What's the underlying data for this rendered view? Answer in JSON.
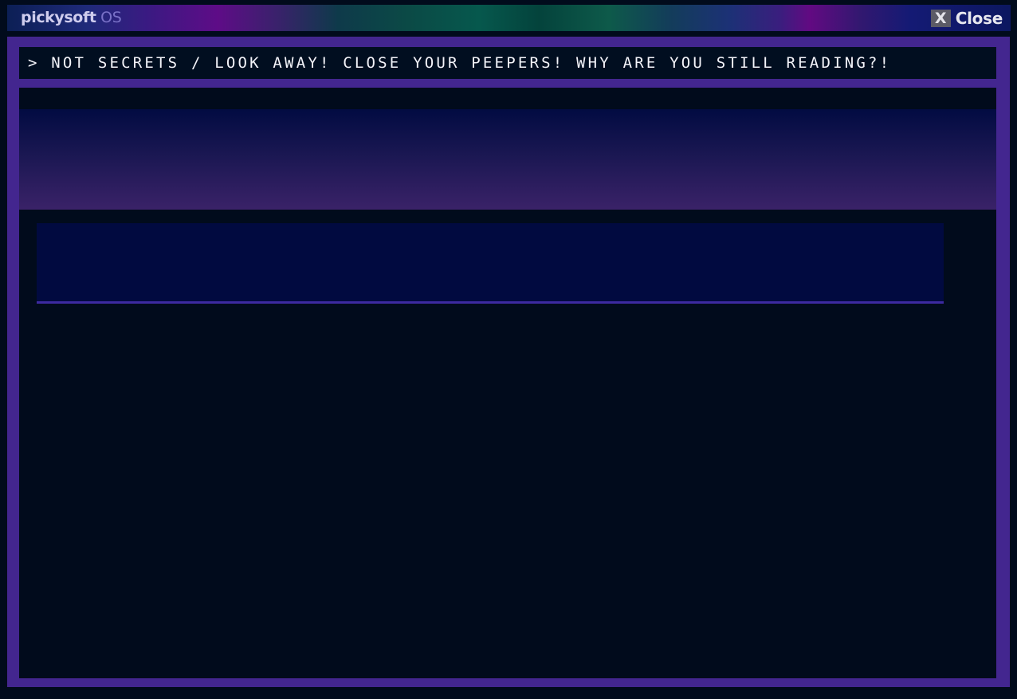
{
  "titlebar": {
    "brand_name": "pickysoft",
    "brand_suffix": "OS",
    "close_icon": "X",
    "close_label": "Close"
  },
  "path_bar": {
    "text": "> NOT SECRETS / LOOK AWAY! CLOSE YOUR PEEPERS! WHY ARE YOU STILL READING?!"
  },
  "colors": {
    "window_border": "#43268f",
    "background": "#010b1c",
    "panel": "#010a40",
    "panel_underline": "#3d2aa0"
  }
}
